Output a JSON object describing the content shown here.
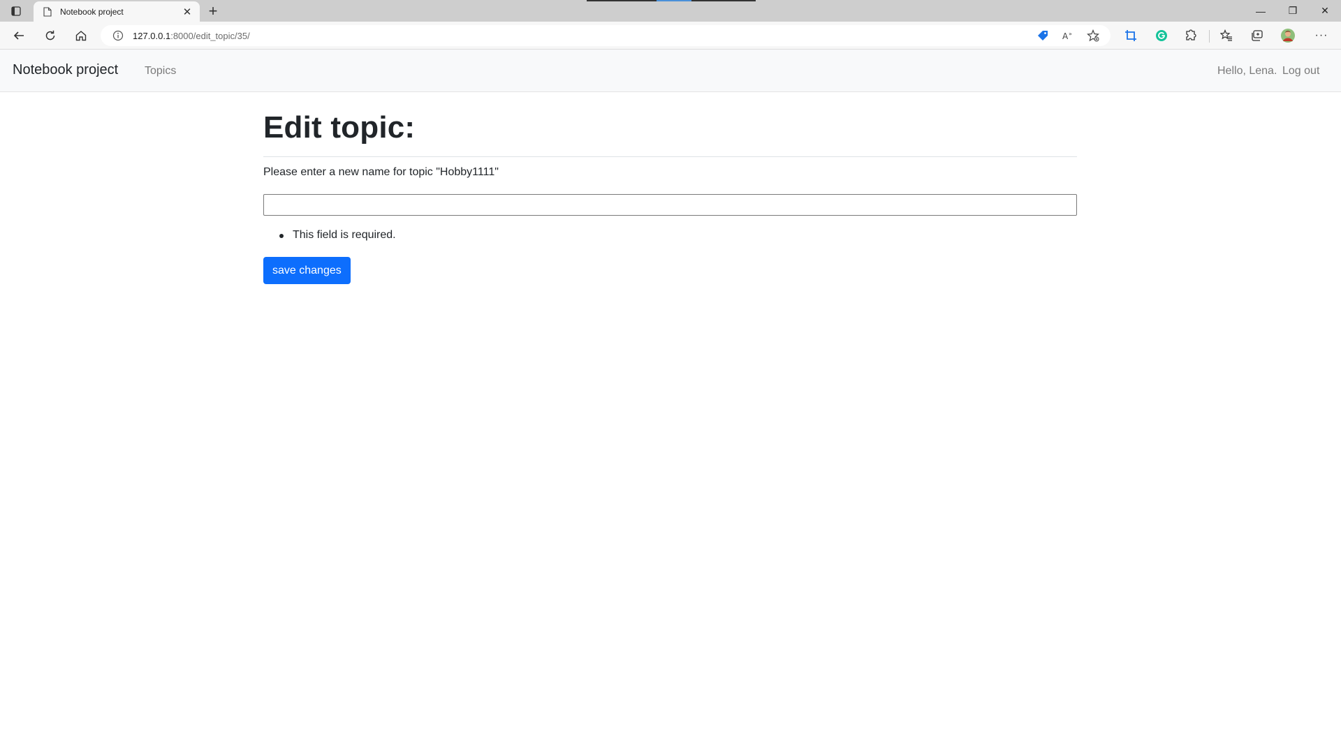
{
  "browser": {
    "tab_title": "Notebook project",
    "tab_close": "✕",
    "new_tab": "+",
    "address": {
      "host": "127.0.0.1",
      "path": ":8000/edit_topic/35/"
    },
    "window_controls": {
      "minimize": "—",
      "restore": "❐",
      "close": "✕"
    },
    "more_label": "···",
    "colors": {
      "tabstrip": "#cecece",
      "toolbar": "#f7f7f7",
      "accent": "#1a73e8",
      "grammarly": "#15c39a"
    }
  },
  "navbar": {
    "brand": "Notebook project",
    "topics_link": "Topics",
    "greeting": "Hello, Lena.",
    "logout_link": "Log out"
  },
  "main": {
    "title": "Edit topic:",
    "prompt": "Please enter a new name for topic \"Hobby1111\"",
    "input_value": "",
    "errors": [
      "This field is required."
    ],
    "save_button": "save changes",
    "colors": {
      "button": "#0d6efd"
    }
  }
}
